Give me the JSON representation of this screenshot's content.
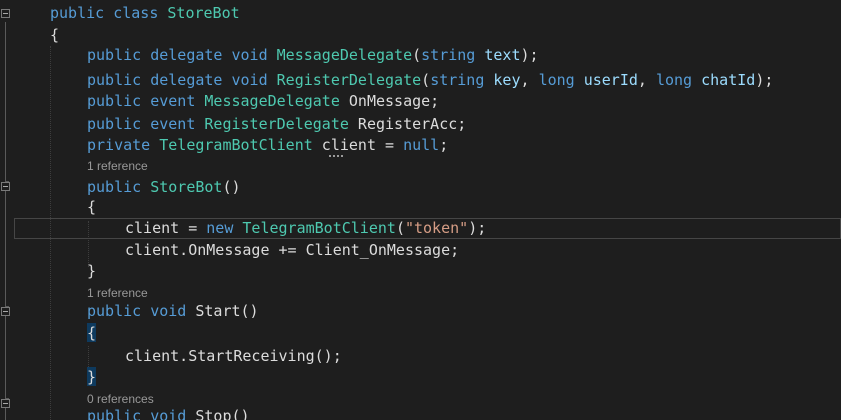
{
  "lines": [
    [
      {
        "t": "public",
        "c": "kw"
      },
      {
        "t": " ",
        "c": "pl"
      },
      {
        "t": "class",
        "c": "kw"
      },
      {
        "t": " ",
        "c": "pl"
      },
      {
        "t": "StoreBot",
        "c": "ty"
      }
    ],
    [
      {
        "t": "{",
        "c": "pl"
      }
    ],
    [
      {
        "t": "public",
        "c": "kw"
      },
      {
        "t": " ",
        "c": "pl"
      },
      {
        "t": "delegate",
        "c": "kw"
      },
      {
        "t": " ",
        "c": "pl"
      },
      {
        "t": "void",
        "c": "kw"
      },
      {
        "t": " ",
        "c": "pl"
      },
      {
        "t": "MessageDelegate",
        "c": "ty"
      },
      {
        "t": "(",
        "c": "pl"
      },
      {
        "t": "string",
        "c": "kw"
      },
      {
        "t": " ",
        "c": "pl"
      },
      {
        "t": "text",
        "c": "pm"
      },
      {
        "t": ");",
        "c": "pl"
      }
    ],
    [
      {
        "t": "public",
        "c": "kw"
      },
      {
        "t": " ",
        "c": "pl"
      },
      {
        "t": "delegate",
        "c": "kw"
      },
      {
        "t": " ",
        "c": "pl"
      },
      {
        "t": "void",
        "c": "kw"
      },
      {
        "t": " ",
        "c": "pl"
      },
      {
        "t": "RegisterDelegate",
        "c": "ty"
      },
      {
        "t": "(",
        "c": "pl"
      },
      {
        "t": "string",
        "c": "kw"
      },
      {
        "t": " ",
        "c": "pl"
      },
      {
        "t": "key",
        "c": "pm"
      },
      {
        "t": ", ",
        "c": "pl"
      },
      {
        "t": "long",
        "c": "kw"
      },
      {
        "t": " ",
        "c": "pl"
      },
      {
        "t": "userId",
        "c": "pm"
      },
      {
        "t": ", ",
        "c": "pl"
      },
      {
        "t": "long",
        "c": "kw"
      },
      {
        "t": " ",
        "c": "pl"
      },
      {
        "t": "chatId",
        "c": "pm"
      },
      {
        "t": ");",
        "c": "pl"
      }
    ],
    [
      {
        "t": "public",
        "c": "kw"
      },
      {
        "t": " ",
        "c": "pl"
      },
      {
        "t": "event",
        "c": "kw"
      },
      {
        "t": " ",
        "c": "pl"
      },
      {
        "t": "MessageDelegate",
        "c": "ty"
      },
      {
        "t": " OnMessage;",
        "c": "pl"
      }
    ],
    [
      {
        "t": "public",
        "c": "kw"
      },
      {
        "t": " ",
        "c": "pl"
      },
      {
        "t": "event",
        "c": "kw"
      },
      {
        "t": " ",
        "c": "pl"
      },
      {
        "t": "RegisterDelegate",
        "c": "ty"
      },
      {
        "t": " RegisterAcc;",
        "c": "pl"
      }
    ],
    [
      {
        "t": "private",
        "c": "kw"
      },
      {
        "t": " ",
        "c": "pl"
      },
      {
        "t": "TelegramBotClient",
        "c": "ty"
      },
      {
        "t": " client = ",
        "c": "pl"
      },
      {
        "t": "null",
        "c": "kw"
      },
      {
        "t": ";",
        "c": "pl"
      }
    ],
    [
      {
        "t": "public",
        "c": "kw"
      },
      {
        "t": " ",
        "c": "pl"
      },
      {
        "t": "StoreBot",
        "c": "ty"
      },
      {
        "t": "()",
        "c": "pl"
      }
    ],
    [
      {
        "t": "{",
        "c": "pl"
      }
    ],
    [
      {
        "t": "client = ",
        "c": "pl"
      },
      {
        "t": "new",
        "c": "kw"
      },
      {
        "t": " ",
        "c": "pl"
      },
      {
        "t": "TelegramBotClient",
        "c": "ty"
      },
      {
        "t": "(",
        "c": "pl"
      },
      {
        "t": "\"token\"",
        "c": "st"
      },
      {
        "t": ");",
        "c": "pl"
      }
    ],
    [
      {
        "t": "client.OnMessage += Client_OnMessage;",
        "c": "pl"
      }
    ],
    [
      {
        "t": "}",
        "c": "pl"
      }
    ],
    [
      {
        "t": "public",
        "c": "kw"
      },
      {
        "t": " ",
        "c": "pl"
      },
      {
        "t": "void",
        "c": "kw"
      },
      {
        "t": " Start()",
        "c": "pl"
      }
    ],
    [
      {
        "t": "{",
        "c": "pl"
      }
    ],
    [
      {
        "t": "client.StartReceiving();",
        "c": "pl"
      }
    ],
    [
      {
        "t": "}",
        "c": "pl"
      }
    ],
    [
      {
        "t": "public",
        "c": "kw"
      },
      {
        "t": " ",
        "c": "pl"
      },
      {
        "t": "void",
        "c": "kw"
      },
      {
        "t": " Stop()",
        "c": "pl"
      }
    ]
  ],
  "lenses": [
    "1 reference",
    "1 reference",
    "0 references"
  ]
}
